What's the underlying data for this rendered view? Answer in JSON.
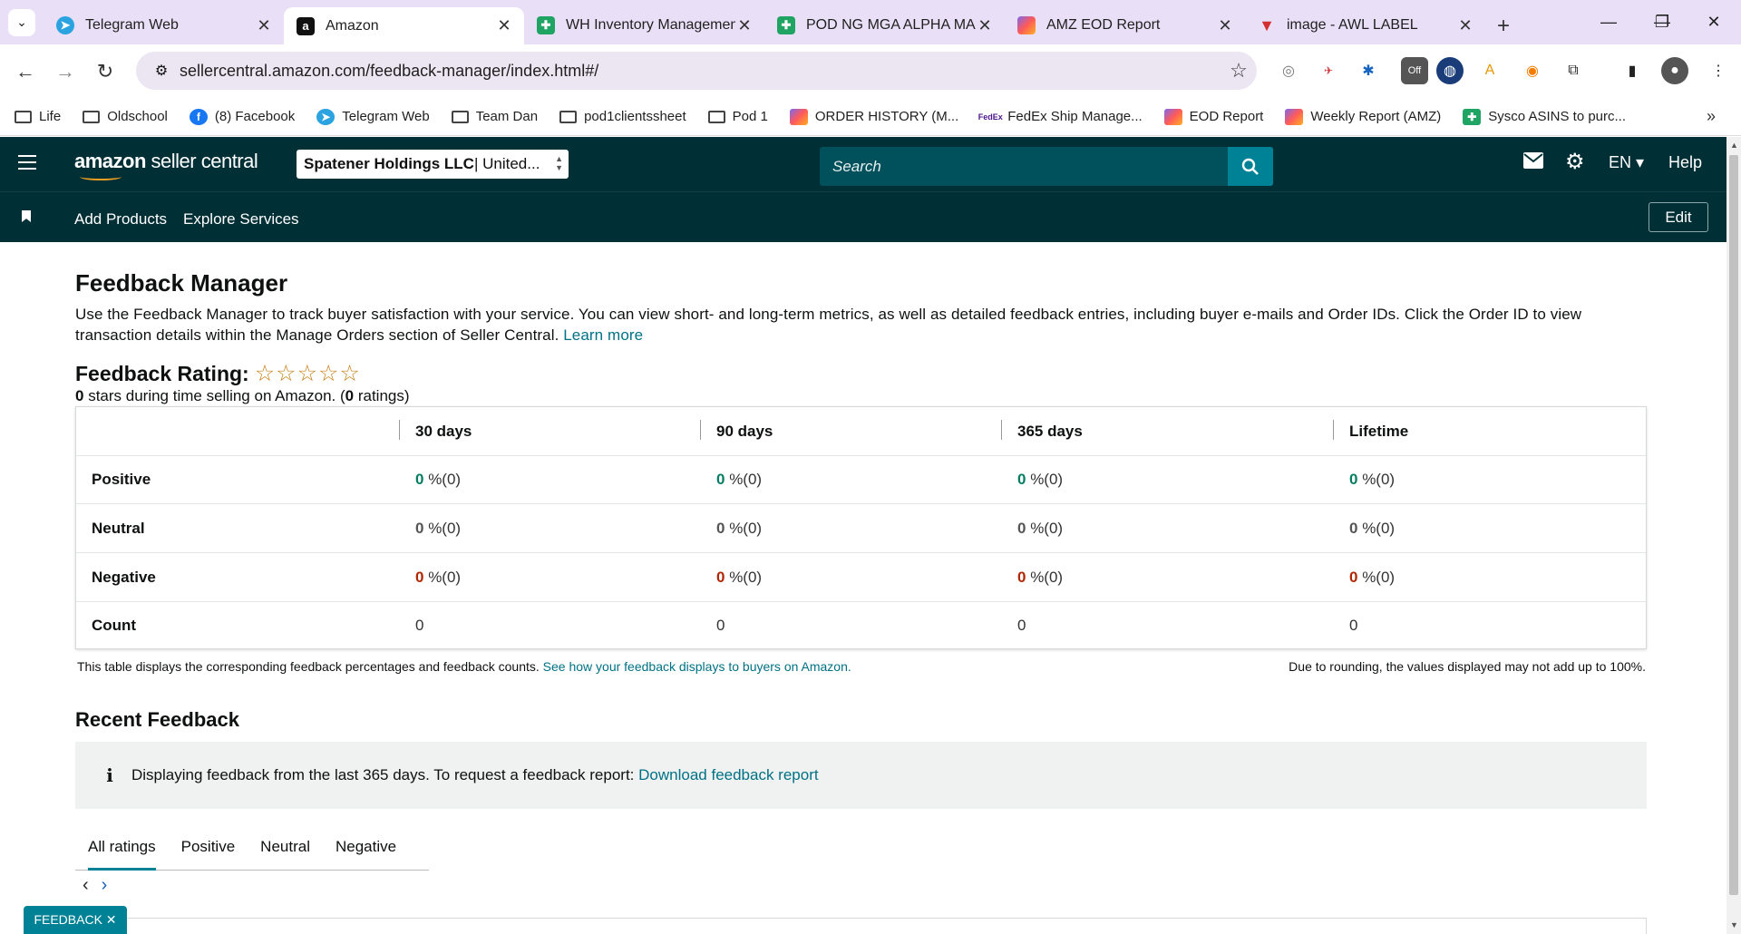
{
  "browser": {
    "tabs": [
      {
        "title": "Telegram Web",
        "icon": "telegram-icon",
        "color": "#2aa3e0"
      },
      {
        "title": "Amazon",
        "icon": "amazon-a-icon",
        "color": "#111111"
      },
      {
        "title": "WH Inventory Managemen",
        "icon": "google-sheets-icon",
        "color": "#1fa463"
      },
      {
        "title": "POD NG MGA ALPHA MAL",
        "icon": "google-sheets-icon",
        "color": "#1fa463"
      },
      {
        "title": "AMZ EOD Report",
        "icon": "clickup-icon",
        "color": "#7b68ee"
      },
      {
        "title": "image - AWL LABEL",
        "icon": "red-triangle-icon",
        "color": "#d32f2f"
      }
    ],
    "url": "sellercentral.amazon.com/feedback-manager/index.html#/",
    "bookmarks": [
      {
        "label": "Life",
        "icon": "folder-icon"
      },
      {
        "label": "Oldschool",
        "icon": "folder-icon"
      },
      {
        "label": "(8) Facebook",
        "icon": "facebook-icon"
      },
      {
        "label": "Telegram Web",
        "icon": "telegram-icon"
      },
      {
        "label": "Team Dan",
        "icon": "folder-icon"
      },
      {
        "label": "pod1clientssheet",
        "icon": "folder-icon"
      },
      {
        "label": "Pod 1",
        "icon": "folder-icon"
      },
      {
        "label": "ORDER HISTORY (M...",
        "icon": "clickup-icon"
      },
      {
        "label": "FedEx Ship Manage...",
        "icon": "fedex-icon"
      },
      {
        "label": "EOD Report",
        "icon": "clickup-icon"
      },
      {
        "label": "Weekly Report (AMZ)",
        "icon": "clickup-icon"
      },
      {
        "label": "Sysco ASINS to purc...",
        "icon": "google-sheets-icon"
      }
    ]
  },
  "header": {
    "logo_bold": "amazon",
    "logo_rest": " seller central",
    "account_bold": "Spatener Holdings LLC",
    "account_rest": " | United...",
    "search_placeholder": "Search",
    "language": "EN",
    "help": "Help",
    "subnav": [
      "Add Products",
      "Explore Services"
    ],
    "edit": "Edit"
  },
  "page": {
    "title": "Feedback Manager",
    "description": "Use the Feedback Manager to track buyer satisfaction with your service. You can view short- and long-term metrics, as well as detailed feedback entries, including buyer e-mails and Order IDs. Click the Order ID to view transaction details within the Manage Orders section of Seller Central. ",
    "learn_more": "Learn more",
    "rating_label": "Feedback Rating:",
    "rating_stars": 0,
    "rating_max": 5,
    "rating_sub_value": "0",
    "rating_sub_text1": " stars during time selling on Amazon. (",
    "rating_sub_count": "0",
    "rating_sub_text2": " ratings)"
  },
  "feedback_table": {
    "columns": [
      "30 days",
      "90 days",
      "365 days",
      "Lifetime"
    ],
    "rows": [
      {
        "label": "Positive",
        "values": [
          "0",
          "0",
          "0",
          "0"
        ],
        "suffix": " %(0)"
      },
      {
        "label": "Neutral",
        "values": [
          "0",
          "0",
          "0",
          "0"
        ],
        "suffix": " %(0)"
      },
      {
        "label": "Negative",
        "values": [
          "0",
          "0",
          "0",
          "0"
        ],
        "suffix": " %(0)"
      },
      {
        "label": "Count",
        "values": [
          "0",
          "0",
          "0",
          "0"
        ],
        "suffix": ""
      }
    ],
    "note": "This table displays the corresponding feedback percentages and feedback counts. ",
    "note_link": "See how your feedback displays to buyers on Amazon.",
    "note_right": "Due to rounding, the values displayed may not add up to 100%."
  },
  "recent": {
    "title": "Recent Feedback",
    "info_text": "Displaying feedback from the last 365 days. To request a feedback report: ",
    "info_link": "Download feedback report",
    "tabs": [
      "All ratings",
      "Positive",
      "Neutral",
      "Negative"
    ],
    "active_tab": "All ratings"
  },
  "feedback_badge": "FEEDBACK ✕"
}
